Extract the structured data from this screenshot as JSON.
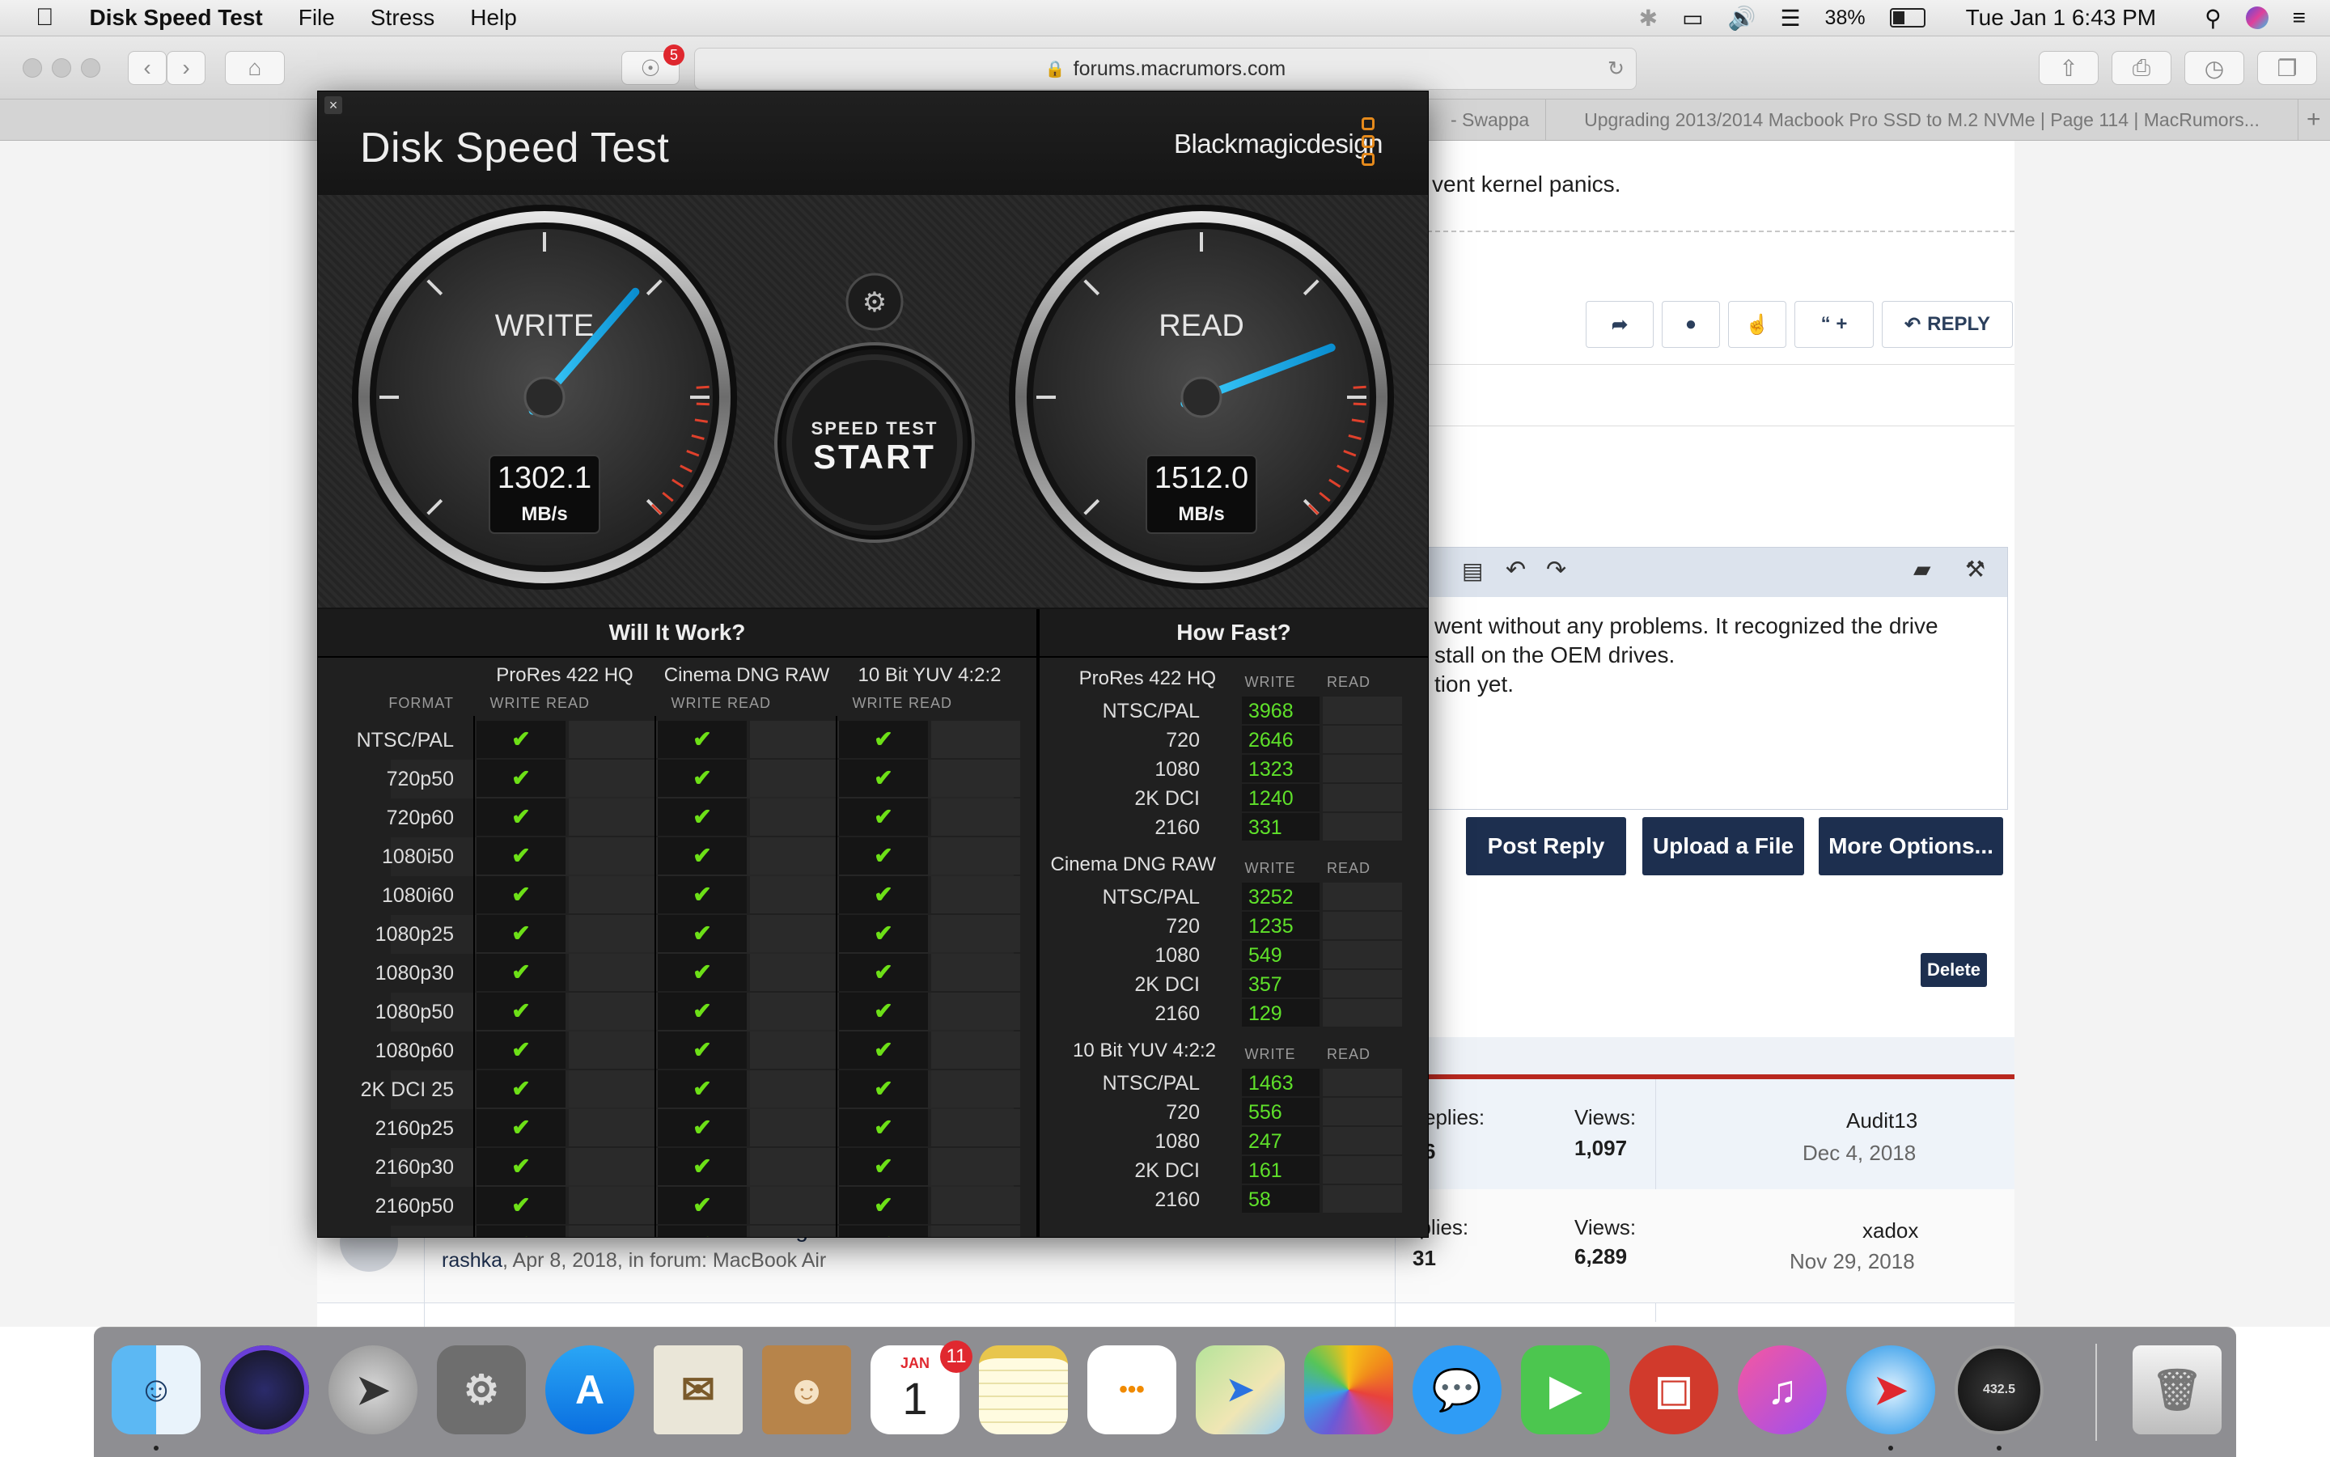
{
  "menubar": {
    "app_name": "Disk Speed Test",
    "menus": [
      "File",
      "Stress",
      "Help"
    ],
    "battery": "38%",
    "clock": "Tue Jan 1  6:43 PM"
  },
  "browser": {
    "url": "forums.macrumors.com",
    "badge": "5",
    "tabs": [
      "- Swappa",
      "Upgrading 2013/2014 Macbook Pro SSD to M.2 NVMe | Page 114 | MacRumors..."
    ],
    "new_tab": "+"
  },
  "forum": {
    "top_text": "vent kernel panics.",
    "action_buttons": {
      "reply": "REPLY",
      "quote": "“ +"
    },
    "editor_lines": [
      "went without any problems. It recognized the drive",
      "stall on the OEM drives.",
      "tion yet."
    ],
    "post_reply": "Post Reply",
    "upload_file": "Upload a File",
    "more_options": "More Options...",
    "delete": "Delete",
    "threads": [
      {
        "replies_label": "eplies:",
        "replies": "6",
        "views_label": "Views:",
        "views": "1,097",
        "last_user": "Audit13",
        "last_date": "Dec 4, 2018"
      },
      {
        "title_fragment": "MacBook Air Mid2013 and Samsung's 960 PRO NVMe M.2 SSD",
        "author": "rashka",
        "meta": ", Apr 8, 2018, in forum: MacBook Air",
        "replies_label": "eplies:",
        "replies": "31",
        "views_label": "Views:",
        "views": "6,289",
        "last_user": "xadox",
        "last_date": "Nov 29, 2018"
      }
    ]
  },
  "dst": {
    "close": "×",
    "title": "Disk Speed Test",
    "brand": "Blackmagicdesign",
    "write_label": "WRITE",
    "read_label": "READ",
    "write_value": "1302.1",
    "read_value": "1512.0",
    "unit": "MB/s",
    "write_mbps": 1302.1,
    "read_mbps": 1512.0,
    "gauge_max_mbps": 2000,
    "start_top": "SPEED TEST",
    "start_main": "START",
    "will_it_work": {
      "header": "Will It Work?",
      "format_label": "FORMAT",
      "codecs": [
        "ProRes 422 HQ",
        "Cinema DNG RAW",
        "10 Bit YUV 4:2:2"
      ],
      "write_label": "WRITE",
      "read_label": "READ",
      "formats": [
        "NTSC/PAL",
        "720p50",
        "720p60",
        "1080i50",
        "1080i60",
        "1080p25",
        "1080p30",
        "1080p50",
        "1080p60",
        "2K DCI 25",
        "2160p25",
        "2160p30",
        "2160p50",
        "2160p60"
      ],
      "check": "✔"
    },
    "how_fast": {
      "header": "How Fast?",
      "write_label": "WRITE",
      "read_label": "READ",
      "groups": [
        {
          "name": "ProRes 422 HQ",
          "rows": [
            {
              "fmt": "NTSC/PAL",
              "write": "3968"
            },
            {
              "fmt": "720",
              "write": "2646"
            },
            {
              "fmt": "1080",
              "write": "1323"
            },
            {
              "fmt": "2K DCI",
              "write": "1240"
            },
            {
              "fmt": "2160",
              "write": "331"
            }
          ]
        },
        {
          "name": "Cinema DNG RAW",
          "rows": [
            {
              "fmt": "NTSC/PAL",
              "write": "3252"
            },
            {
              "fmt": "720",
              "write": "1235"
            },
            {
              "fmt": "1080",
              "write": "549"
            },
            {
              "fmt": "2K DCI",
              "write": "357"
            },
            {
              "fmt": "2160",
              "write": "129"
            }
          ]
        },
        {
          "name": "10 Bit YUV 4:2:2",
          "rows": [
            {
              "fmt": "NTSC/PAL",
              "write": "1463"
            },
            {
              "fmt": "720",
              "write": "556"
            },
            {
              "fmt": "1080",
              "write": "247"
            },
            {
              "fmt": "2K DCI",
              "write": "161"
            },
            {
              "fmt": "2160",
              "write": "58"
            }
          ]
        }
      ]
    }
  },
  "dock": {
    "calendar_month": "JAN",
    "calendar_day": "1",
    "calendar_badge": "11",
    "speed_app_value": "432.5",
    "icons": [
      "finder-icon",
      "siri-icon",
      "launchpad-icon",
      "system-preferences-icon",
      "app-store-icon",
      "mail-icon",
      "contacts-icon",
      "calendar-icon",
      "notes-icon",
      "reminders-icon",
      "maps-icon",
      "photos-icon",
      "messages-icon",
      "facetime-icon",
      "photo-booth-icon",
      "itunes-icon",
      "safari-icon",
      "disk-speed-test-icon",
      "trash-icon"
    ]
  }
}
